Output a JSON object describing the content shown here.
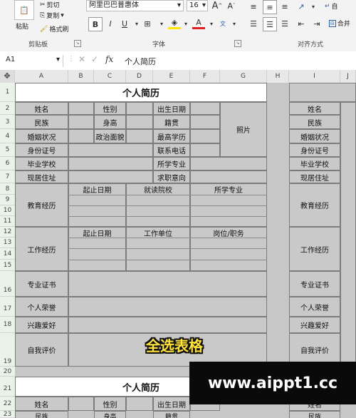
{
  "ribbon": {
    "cut": "剪切",
    "copy": "复制",
    "format_painter": "格式刷",
    "paste": "粘贴",
    "clipboard_group": "剪贴板",
    "font_name": "阿里巴巴普惠体",
    "font_size": "16",
    "bold": "B",
    "italic": "I",
    "underline": "U",
    "font_group": "字体",
    "align_group": "对齐方式",
    "merge_label": "合并",
    "auto_label": "自"
  },
  "formula_bar": {
    "cell_ref": "A1",
    "fx": "fx",
    "content": "个人简历"
  },
  "columns": [
    "A",
    "B",
    "C",
    "D",
    "E",
    "F",
    "G",
    "H",
    "I",
    "J"
  ],
  "rows": [
    "1",
    "2",
    "3",
    "4",
    "5",
    "6",
    "7",
    "8",
    "9",
    "10",
    "11",
    "12",
    "13",
    "14",
    "15",
    "16",
    "17",
    "18",
    "19",
    "20",
    "21",
    "22",
    "23"
  ],
  "resume": {
    "title": "个人简历",
    "name": "姓名",
    "gender": "性别",
    "birth": "出生日期",
    "ethnicity": "民族",
    "height": "身高",
    "native_place": "籍贯",
    "photo": "照片",
    "marital": "婚姻状况",
    "political": "政治面貌",
    "education_level": "最高学历",
    "id_number": "身份证号",
    "phone": "联系电话",
    "school": "毕业学校",
    "major": "所学专业",
    "address": "现居住址",
    "intention": "求职意向",
    "edu_exp": "教育经历",
    "start_end": "起止日期",
    "school_col": "就读院校",
    "major_col": "所学专业",
    "work_exp": "工作经历",
    "work_unit": "工作单位",
    "position": "岗位/职务",
    "cert": "专业证书",
    "honor": "个人荣誉",
    "hobby": "兴趣爱好",
    "self_eval": "自我评价"
  },
  "copy_right": {
    "name": "姓名",
    "ethnicity": "民族",
    "marital": "婚姻状况",
    "id_number": "身份证号",
    "school": "毕业学校",
    "address": "现居住址",
    "edu_exp": "教育经历",
    "work_exp": "工作经历",
    "cert": "专业证书",
    "honor": "个人荣誉",
    "hobby": "兴趣爱好",
    "self_eval": "自我评价",
    "name_cut": "姓名",
    "eth_cut": "民族"
  },
  "resume2": {
    "title": "个人简历",
    "name": "姓名",
    "gender": "性别",
    "birth": "出生日期",
    "ethnicity": "民族",
    "height": "身高",
    "native_place": "籍贯"
  },
  "overlay_text": "全选表格",
  "watermark": "www.aippt1.cc",
  "colors": {
    "grid_bg": "#c9c9c9",
    "title_bg": "#ffffff",
    "overlay": "#ffe23a",
    "watermark_bg": "#0a0a0a"
  }
}
